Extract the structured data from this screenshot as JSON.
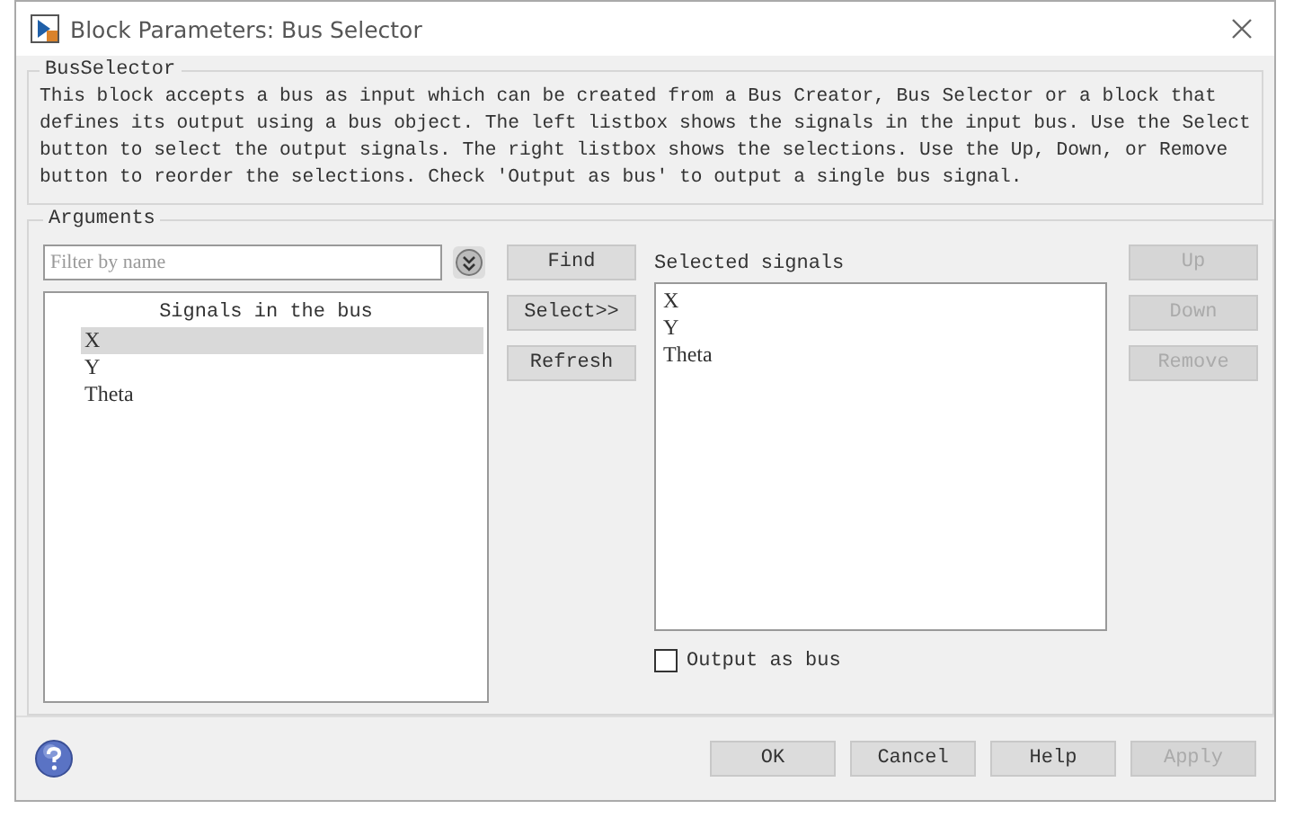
{
  "window": {
    "title": "Block Parameters: Bus Selector"
  },
  "description_group": {
    "title": "BusSelector",
    "text": "This block accepts a bus as input which can be created from a Bus Creator, Bus Selector or a block that defines its output using a bus object. The left listbox shows the signals in the input bus. Use the Select button to select the output signals. The right listbox shows the selections. Use the Up, Down, or Remove button to reorder the selections. Check 'Output as bus' to output a single bus signal."
  },
  "arguments": {
    "title": "Arguments",
    "filter": {
      "placeholder": "Filter by name"
    },
    "signals_list": {
      "heading": "Signals in the bus",
      "items": [
        {
          "label": "X",
          "selected": true
        },
        {
          "label": "Y",
          "selected": false
        },
        {
          "label": "Theta",
          "selected": false
        }
      ]
    },
    "middle_buttons": [
      {
        "label": "Find",
        "disabled": false
      },
      {
        "label": "Select>>",
        "disabled": false
      },
      {
        "label": "Refresh",
        "disabled": false
      }
    ],
    "selected_list": {
      "heading": "Selected signals",
      "items": [
        {
          "label": "X",
          "selected": false
        },
        {
          "label": "Y",
          "selected": false
        },
        {
          "label": "Theta",
          "selected": false
        }
      ]
    },
    "right_buttons": [
      {
        "label": "Up",
        "disabled": true
      },
      {
        "label": "Down",
        "disabled": true
      },
      {
        "label": "Remove",
        "disabled": true
      }
    ],
    "output_as_bus": {
      "label": "Output as bus",
      "checked": false
    }
  },
  "footer_buttons": [
    {
      "label": "OK",
      "disabled": false
    },
    {
      "label": "Cancel",
      "disabled": false
    },
    {
      "label": "Help",
      "disabled": false
    },
    {
      "label": "Apply",
      "disabled": true
    }
  ]
}
